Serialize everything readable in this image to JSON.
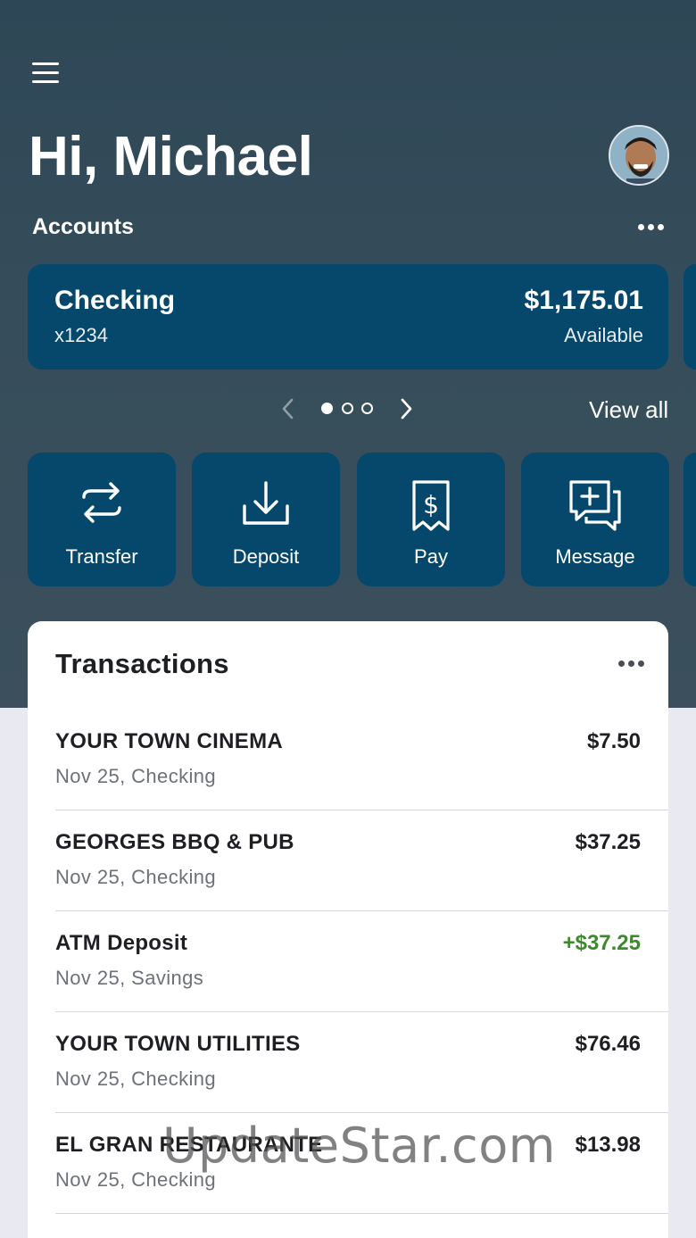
{
  "header": {
    "greeting": "Hi, Michael"
  },
  "accounts": {
    "label": "Accounts",
    "card": {
      "name": "Checking",
      "number": "x1234",
      "balance": "$1,175.01",
      "balance_label": "Available"
    },
    "pager": {
      "pages": 3,
      "active_index": 0
    },
    "view_all": "View all"
  },
  "actions": [
    {
      "label": "Transfer",
      "icon": "transfer-icon"
    },
    {
      "label": "Deposit",
      "icon": "deposit-icon"
    },
    {
      "label": "Pay",
      "icon": "pay-bill-icon"
    },
    {
      "label": "Message",
      "icon": "message-icon"
    }
  ],
  "transactions": {
    "title": "Transactions",
    "items": [
      {
        "name": "YOUR TOWN CINEMA",
        "meta": "Nov 25, Checking",
        "amount": "$7.50",
        "credit": false
      },
      {
        "name": "GEORGES BBQ & PUB",
        "meta": "Nov 25, Checking",
        "amount": "$37.25",
        "credit": false
      },
      {
        "name": "ATM Deposit",
        "meta": "Nov 25, Savings",
        "amount": "+$37.25",
        "credit": true
      },
      {
        "name": "YOUR TOWN UTILITIES",
        "meta": "Nov 25, Checking",
        "amount": "$76.46",
        "credit": false
      },
      {
        "name": "EL GRAN RESTAURANTE",
        "meta": "Nov 25, Checking",
        "amount": "$13.98",
        "credit": false
      }
    ]
  },
  "watermark": "UpdateStar.com",
  "colors": {
    "card_blue": "#05486c",
    "credit_green": "#3d8a2c",
    "background": "#e9eaf1"
  }
}
